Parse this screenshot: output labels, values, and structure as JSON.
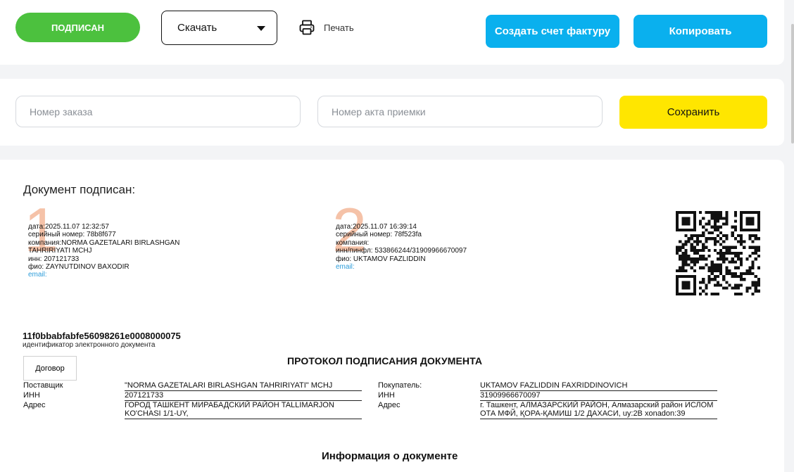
{
  "toolbar": {
    "status_label": "ПОДПИСАН",
    "download": {
      "value": "Скачать"
    },
    "print_label": "Печать",
    "create_invoice_label": "Создать счет фактуру",
    "copy_label": "Копировать"
  },
  "order_form": {
    "order_number_placeholder": "Номер заказа",
    "act_number_placeholder": "Номер акта приемки",
    "save_label": "Сохранить"
  },
  "document": {
    "heading": "Документ подписан:",
    "signatures": [
      {
        "number": "1",
        "lines": [
          "дата:2025.11.07 12:32:57",
          "серийный номер: 78b8f677",
          "компания:NORMA GAZETALARI BIRLASHGAN",
          "TAHRIRIYATI MCHJ",
          "инн: 207121733",
          "фио: ZAYNUTDINOV BAXODIR"
        ],
        "email_label": "email:"
      },
      {
        "number": "2",
        "lines": [
          "дата:2025.11.07 16:39:14",
          "серийный номер: 78f523fa",
          "компания:",
          "инн/пинфл: 533866244/31909966670097",
          "фио: UKTAMOV FAZLIDDIN"
        ],
        "email_label": "email:"
      }
    ],
    "id": "11f0bbabfabfe56098261e0008000075",
    "id_label": "идентификатор электронного документа",
    "contract_button": "Договор",
    "protocol_title": "ПРОТОКОЛ ПОДПИСАНИЯ ДОКУМЕНТА",
    "supplier": {
      "label": "Поставщик",
      "name": "\"NORMA GAZETALARI BIRLASHGAN TAHRIRIYATI\" MCHJ",
      "inn_label": "ИНН",
      "inn": "207121733",
      "address_label": "Адрес",
      "address": "ГОРОД ТАШКЕНТ МИРАБАДСКИЙ РАЙОН TALLIMARJON KO'CHASI 1/1-UY,"
    },
    "buyer": {
      "label": "Покупатель:",
      "name": "UKTAMOV FAZLIDDIN FAXRIDDINOVICH",
      "inn_label": "ИНН",
      "inn": "31909966670097",
      "address_label": "Адрес",
      "address": "г. Ташкент, АЛМАЗАРСКИЙ РАЙОН, Алмазарский район ИСЛОМ ОТА МФЙ, ҚОРА-ҚАМИШ 1/2 ДАХАСИ, uy:2B xonadon:39"
    },
    "info_title": "Информация о документе"
  },
  "colors": {
    "signed_green": "#4cc13e",
    "action_blue": "#0ab0ee",
    "save_yellow": "#ffe600",
    "signature_number": "#f5c2a8",
    "email_link": "#2c9cd9"
  }
}
